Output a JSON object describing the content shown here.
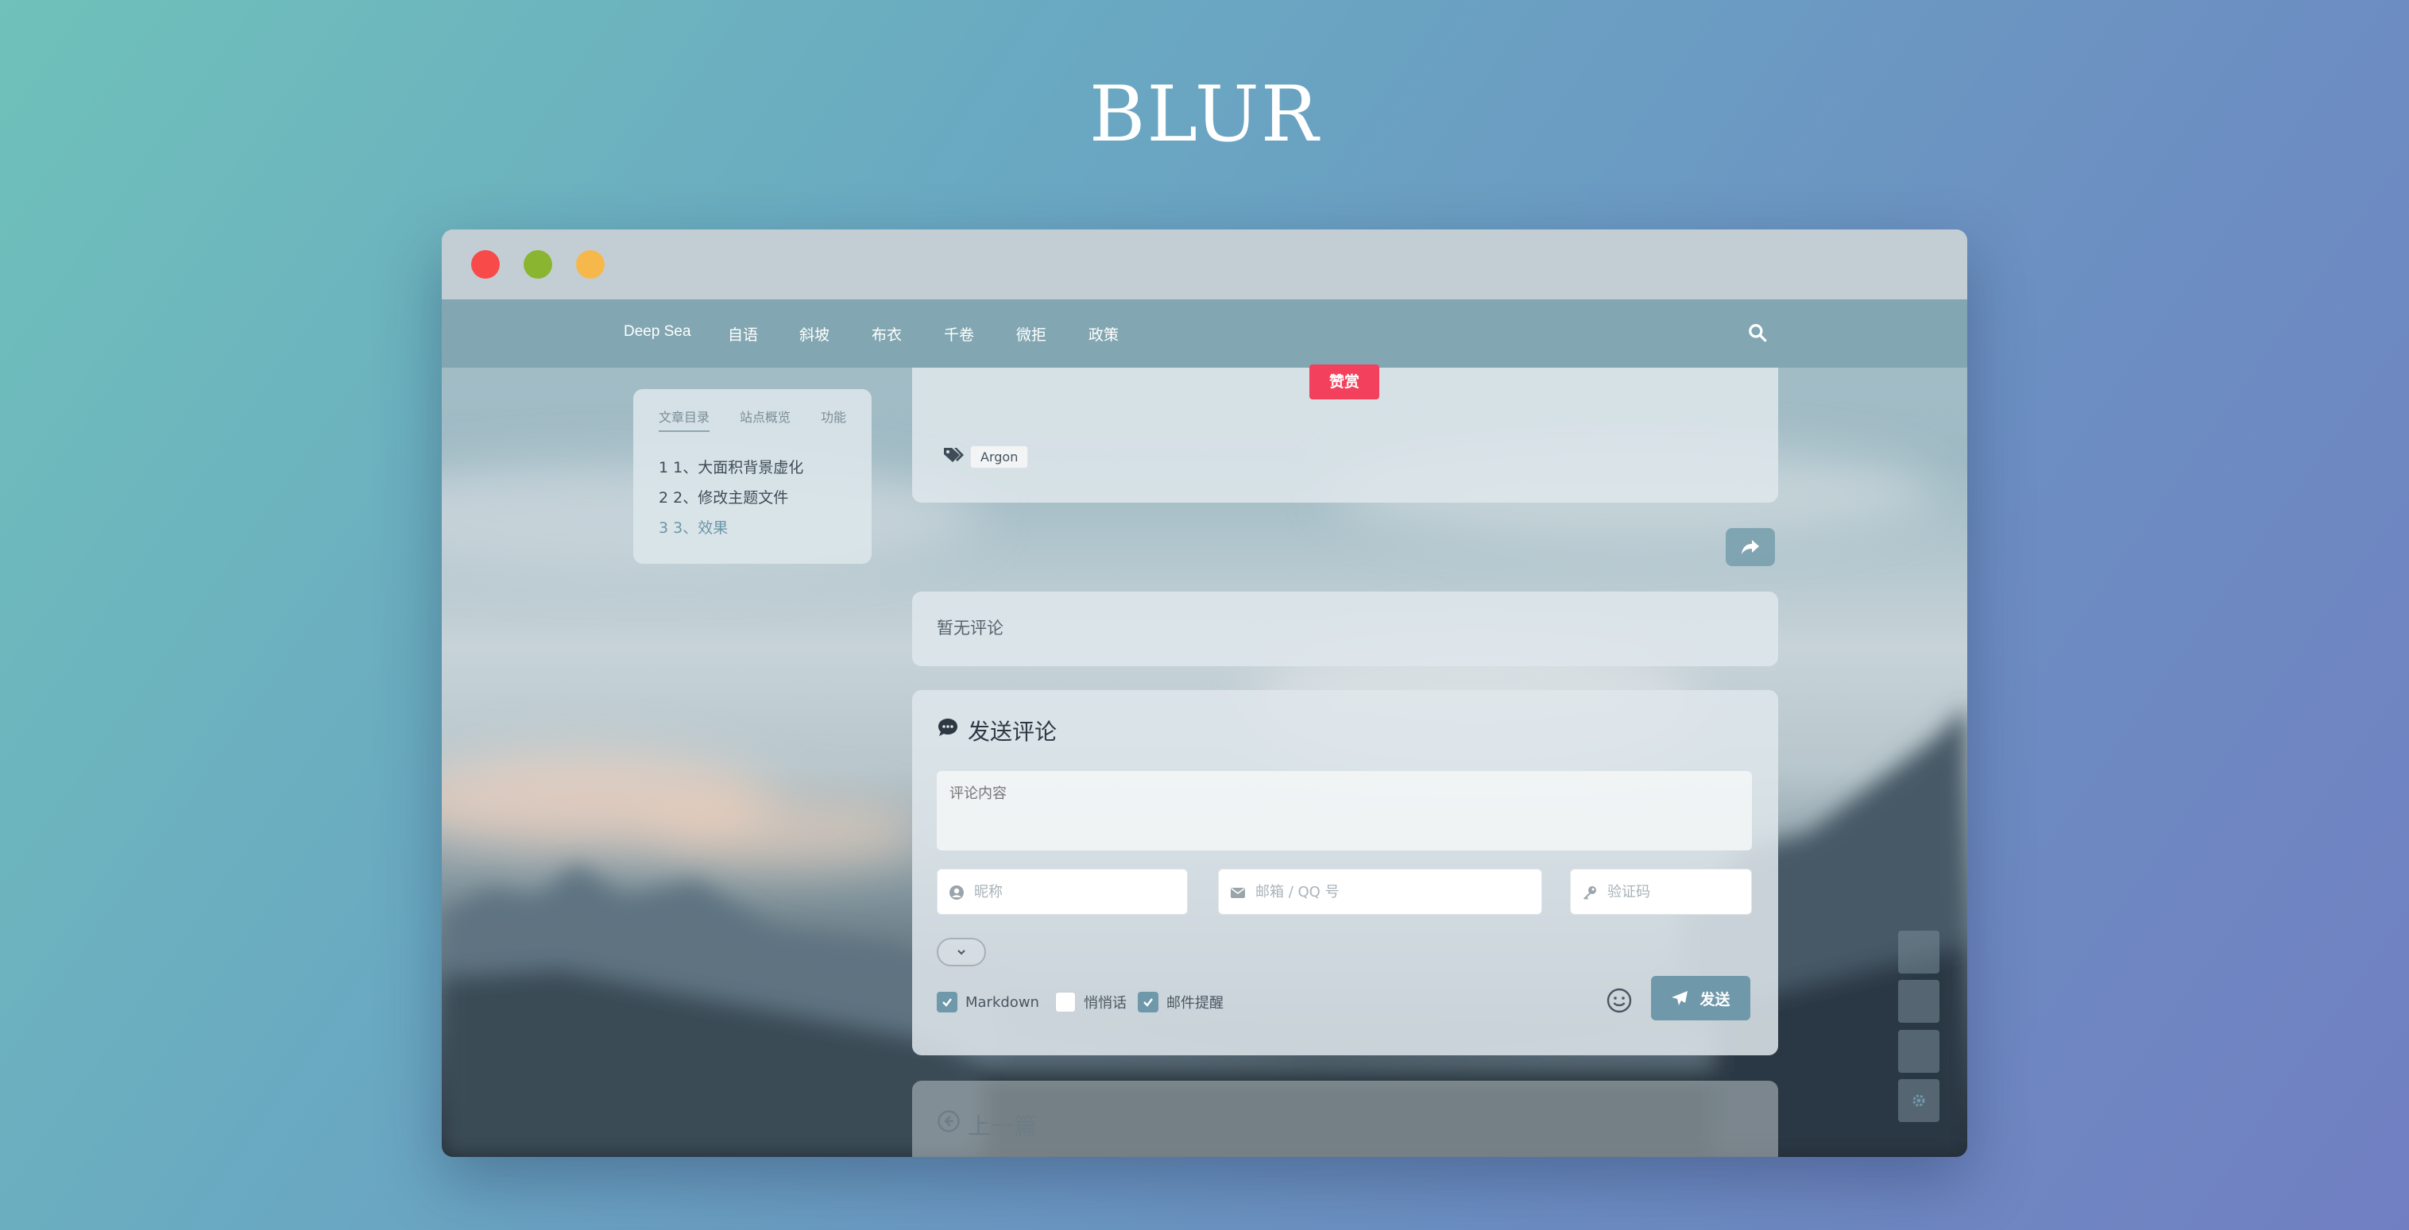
{
  "hero": {
    "title": "BLUR"
  },
  "window": {
    "traffic_lights": [
      "#f94a4a",
      "#8ab531",
      "#f7b84b"
    ]
  },
  "navbar": {
    "brand": "Deep Sea",
    "items": [
      "自语",
      "斜坡",
      "布衣",
      "千卷",
      "微拒",
      "政策"
    ],
    "search_icon": "search-icon"
  },
  "toc": {
    "tabs": [
      "文章目录",
      "站点概览",
      "功能"
    ],
    "items": [
      "1 1、大面积背景虚化",
      "2 2、修改主题文件",
      "3 3、效果"
    ]
  },
  "article": {
    "reward_label": "赞赏",
    "tag": "Argon"
  },
  "comments": {
    "empty_label": "暂无评论"
  },
  "comment_form": {
    "title": "发送评论",
    "content_placeholder": "评论内容",
    "nickname_placeholder": "昵称",
    "email_placeholder": "邮箱 / QQ 号",
    "captcha_placeholder": "验证码",
    "options": [
      {
        "label": "Markdown",
        "checked": true
      },
      {
        "label": "悄悄话",
        "checked": false
      },
      {
        "label": "邮件提醒",
        "checked": true
      }
    ],
    "send_label": "发送"
  },
  "navigation": {
    "prev_label": "上一篇"
  },
  "colors": {
    "accent": "#6f98aa",
    "reward": "#f3405c"
  }
}
